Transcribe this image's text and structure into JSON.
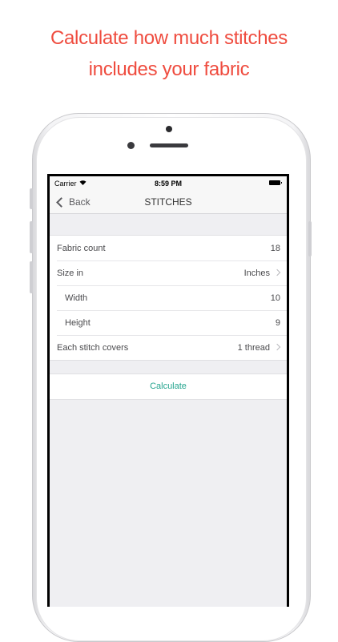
{
  "headline": {
    "line1": "Calculate how much stitches",
    "line2": "includes your fabric"
  },
  "status_bar": {
    "carrier": "Carrier",
    "time": "8:59 PM"
  },
  "nav": {
    "back_label": "Back",
    "title": "STITCHES"
  },
  "form": {
    "rows": [
      {
        "label": "Fabric count",
        "value": "18"
      },
      {
        "label": "Size in",
        "value": "Inches"
      },
      {
        "label": "Width",
        "value": "10"
      },
      {
        "label": "Height",
        "value": "9"
      },
      {
        "label": "Each stitch covers",
        "value": "1 thread"
      }
    ]
  },
  "actions": {
    "calculate_label": "Calculate"
  },
  "colors": {
    "headline": "#ef4c3f",
    "accent": "#25a58f",
    "background": "#efeff2"
  }
}
